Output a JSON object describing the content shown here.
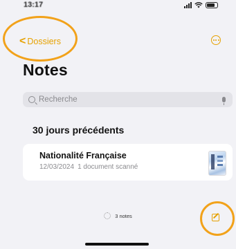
{
  "status_bar": {
    "time": "13:17"
  },
  "nav": {
    "back_label": "Dossiers",
    "back_chevron": "<",
    "more_icon": "ellipsis-circle-icon"
  },
  "page": {
    "title": "Notes"
  },
  "search": {
    "placeholder": "Recherche"
  },
  "section": {
    "header": "30 jours précédents"
  },
  "notes": [
    {
      "title": "Nationalité Française",
      "date": "12/03/2024",
      "detail": "1 document scanné",
      "thumbnail": "scanned-document-thumbnail"
    }
  ],
  "footer": {
    "count_label": "3 notes",
    "compose_icon": "compose-icon"
  },
  "colors": {
    "accent": "#e6a100",
    "highlight": "#f2a21a",
    "background": "#f2f2f6"
  }
}
